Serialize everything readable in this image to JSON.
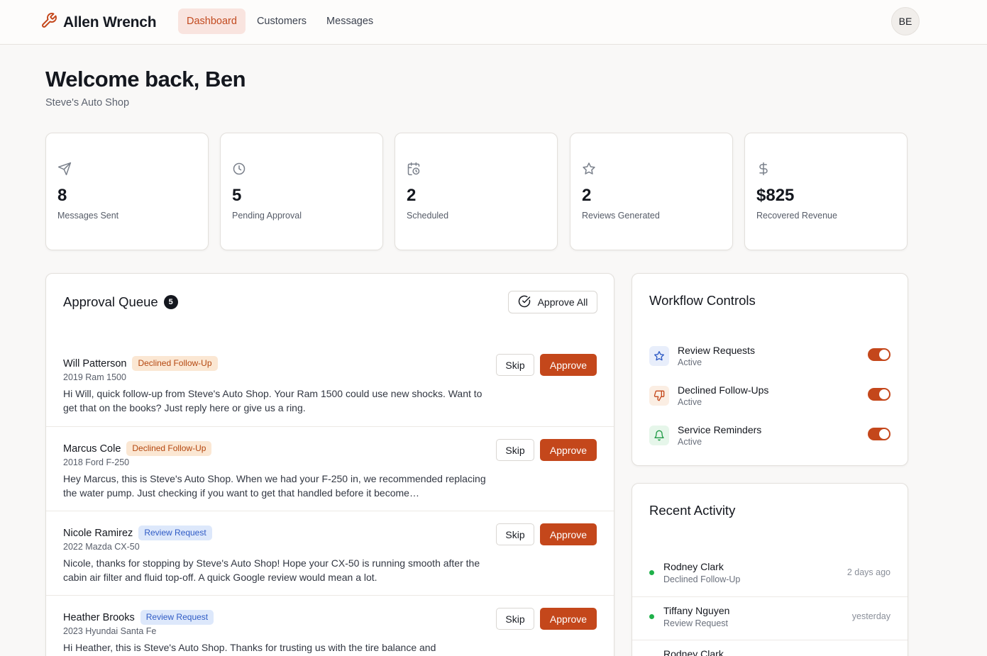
{
  "brand": {
    "name": "Allen Wrench"
  },
  "nav": [
    {
      "label": "Dashboard",
      "active": true
    },
    {
      "label": "Customers",
      "active": false
    },
    {
      "label": "Messages",
      "active": false
    }
  ],
  "user": {
    "initials": "BE"
  },
  "welcome": {
    "title": "Welcome back, Ben",
    "shop": "Steve's Auto Shop"
  },
  "stats": [
    {
      "icon": "send-icon",
      "value": "8",
      "label": "Messages Sent"
    },
    {
      "icon": "clock-icon",
      "value": "5",
      "label": "Pending Approval"
    },
    {
      "icon": "calendar-clock-icon",
      "value": "2",
      "label": "Scheduled"
    },
    {
      "icon": "star-icon",
      "value": "2",
      "label": "Reviews Generated"
    },
    {
      "icon": "dollar-icon",
      "value": "$825",
      "label": "Recovered Revenue"
    }
  ],
  "queue": {
    "title": "Approval Queue",
    "count": "5",
    "approve_all_label": "Approve All",
    "skip_label": "Skip",
    "approve_label": "Approve",
    "items": [
      {
        "name": "Will Patterson",
        "tag": "Declined Follow-Up",
        "tag_color": "orange",
        "vehicle": "2019 Ram 1500",
        "message": "Hi Will, quick follow-up from Steve's Auto Shop. Your Ram 1500 could use new shocks. Want to get that on the books? Just reply here or give us a ring."
      },
      {
        "name": "Marcus Cole",
        "tag": "Declined Follow-Up",
        "tag_color": "orange",
        "vehicle": "2018 Ford F-250",
        "message": "Hey Marcus, this is Steve's Auto Shop. When we had your F-250 in, we recommended replacing the water pump. Just checking if you want to get that handled before it become…"
      },
      {
        "name": "Nicole Ramirez",
        "tag": "Review Request",
        "tag_color": "blue",
        "vehicle": "2022 Mazda CX-50",
        "message": "Nicole, thanks for stopping by Steve's Auto Shop! Hope your CX-50 is running smooth after the cabin air filter and fluid top-off. A quick Google review would mean a lot."
      },
      {
        "name": "Heather Brooks",
        "tag": "Review Request",
        "tag_color": "blue",
        "vehicle": "2023 Hyundai Santa Fe",
        "message": "Hi Heather, this is Steve's Auto Shop. Thanks for trusting us with the tire balance and"
      }
    ]
  },
  "workflow": {
    "title": "Workflow Controls",
    "items": [
      {
        "icon": "star-icon",
        "name": "Review Requests",
        "status": "Active",
        "enabled": true
      },
      {
        "icon": "thumbs-down-icon",
        "name": "Declined Follow-Ups",
        "status": "Active",
        "enabled": true
      },
      {
        "icon": "bell-icon",
        "name": "Service Reminders",
        "status": "Active",
        "enabled": true
      }
    ]
  },
  "activity": {
    "title": "Recent Activity",
    "items": [
      {
        "name": "Rodney Clark",
        "type": "Declined Follow-Up",
        "time": "2 days ago"
      },
      {
        "name": "Tiffany Nguyen",
        "type": "Review Request",
        "time": "yesterday"
      },
      {
        "name": "Rodney Clark",
        "type": "",
        "time": ""
      }
    ]
  },
  "colors": {
    "accent": "#c4471b",
    "accent_soft": "#f9e4df",
    "success": "#1fb14a"
  }
}
